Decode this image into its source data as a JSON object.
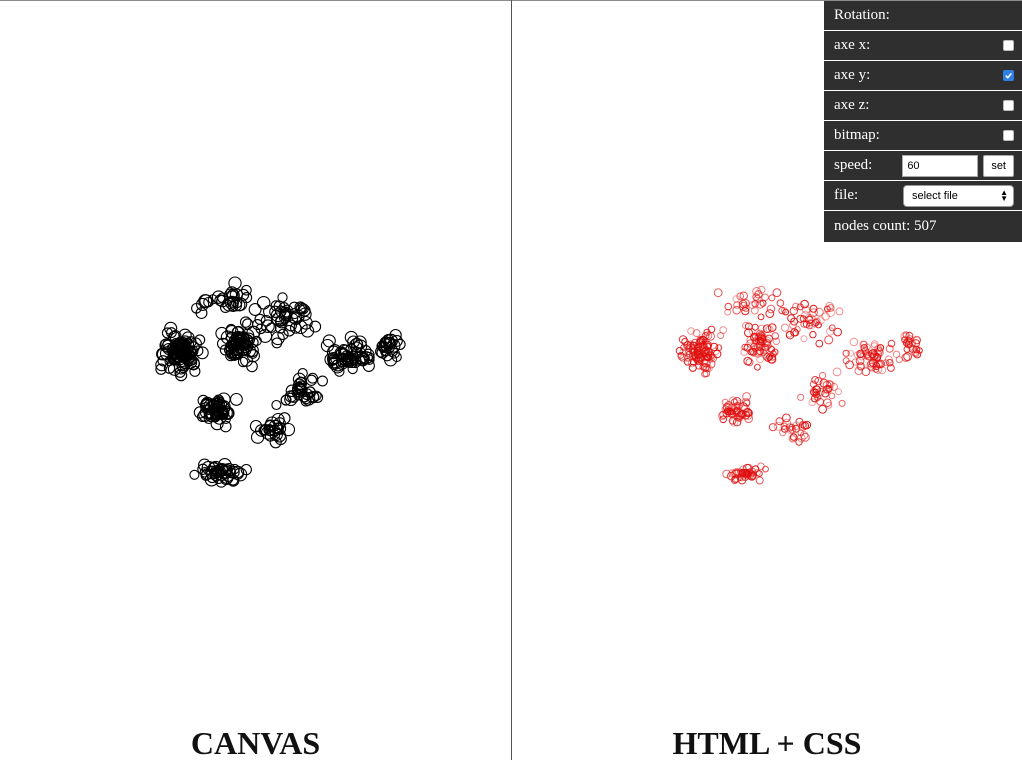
{
  "panes": {
    "left": {
      "title": "CANVAS"
    },
    "right": {
      "title": "HTML + CSS"
    }
  },
  "panel": {
    "rotation_label": "Rotation:",
    "axe_x": {
      "label": "axe x:",
      "checked": false
    },
    "axe_y": {
      "label": "axe y:",
      "checked": true
    },
    "axe_z": {
      "label": "axe z:",
      "checked": false
    },
    "bitmap": {
      "label": "bitmap:",
      "checked": false
    },
    "speed": {
      "label": "speed:",
      "value": "60",
      "button": "set"
    },
    "file": {
      "label": "file:",
      "selected": "select file"
    },
    "nodes_count_label": "nodes count: 507"
  },
  "colors": {
    "canvas_nodes": "#000000",
    "html_nodes": "#e01010",
    "panel_bg": "#2f2f2f",
    "checkbox_on": "#2f7ee6"
  }
}
